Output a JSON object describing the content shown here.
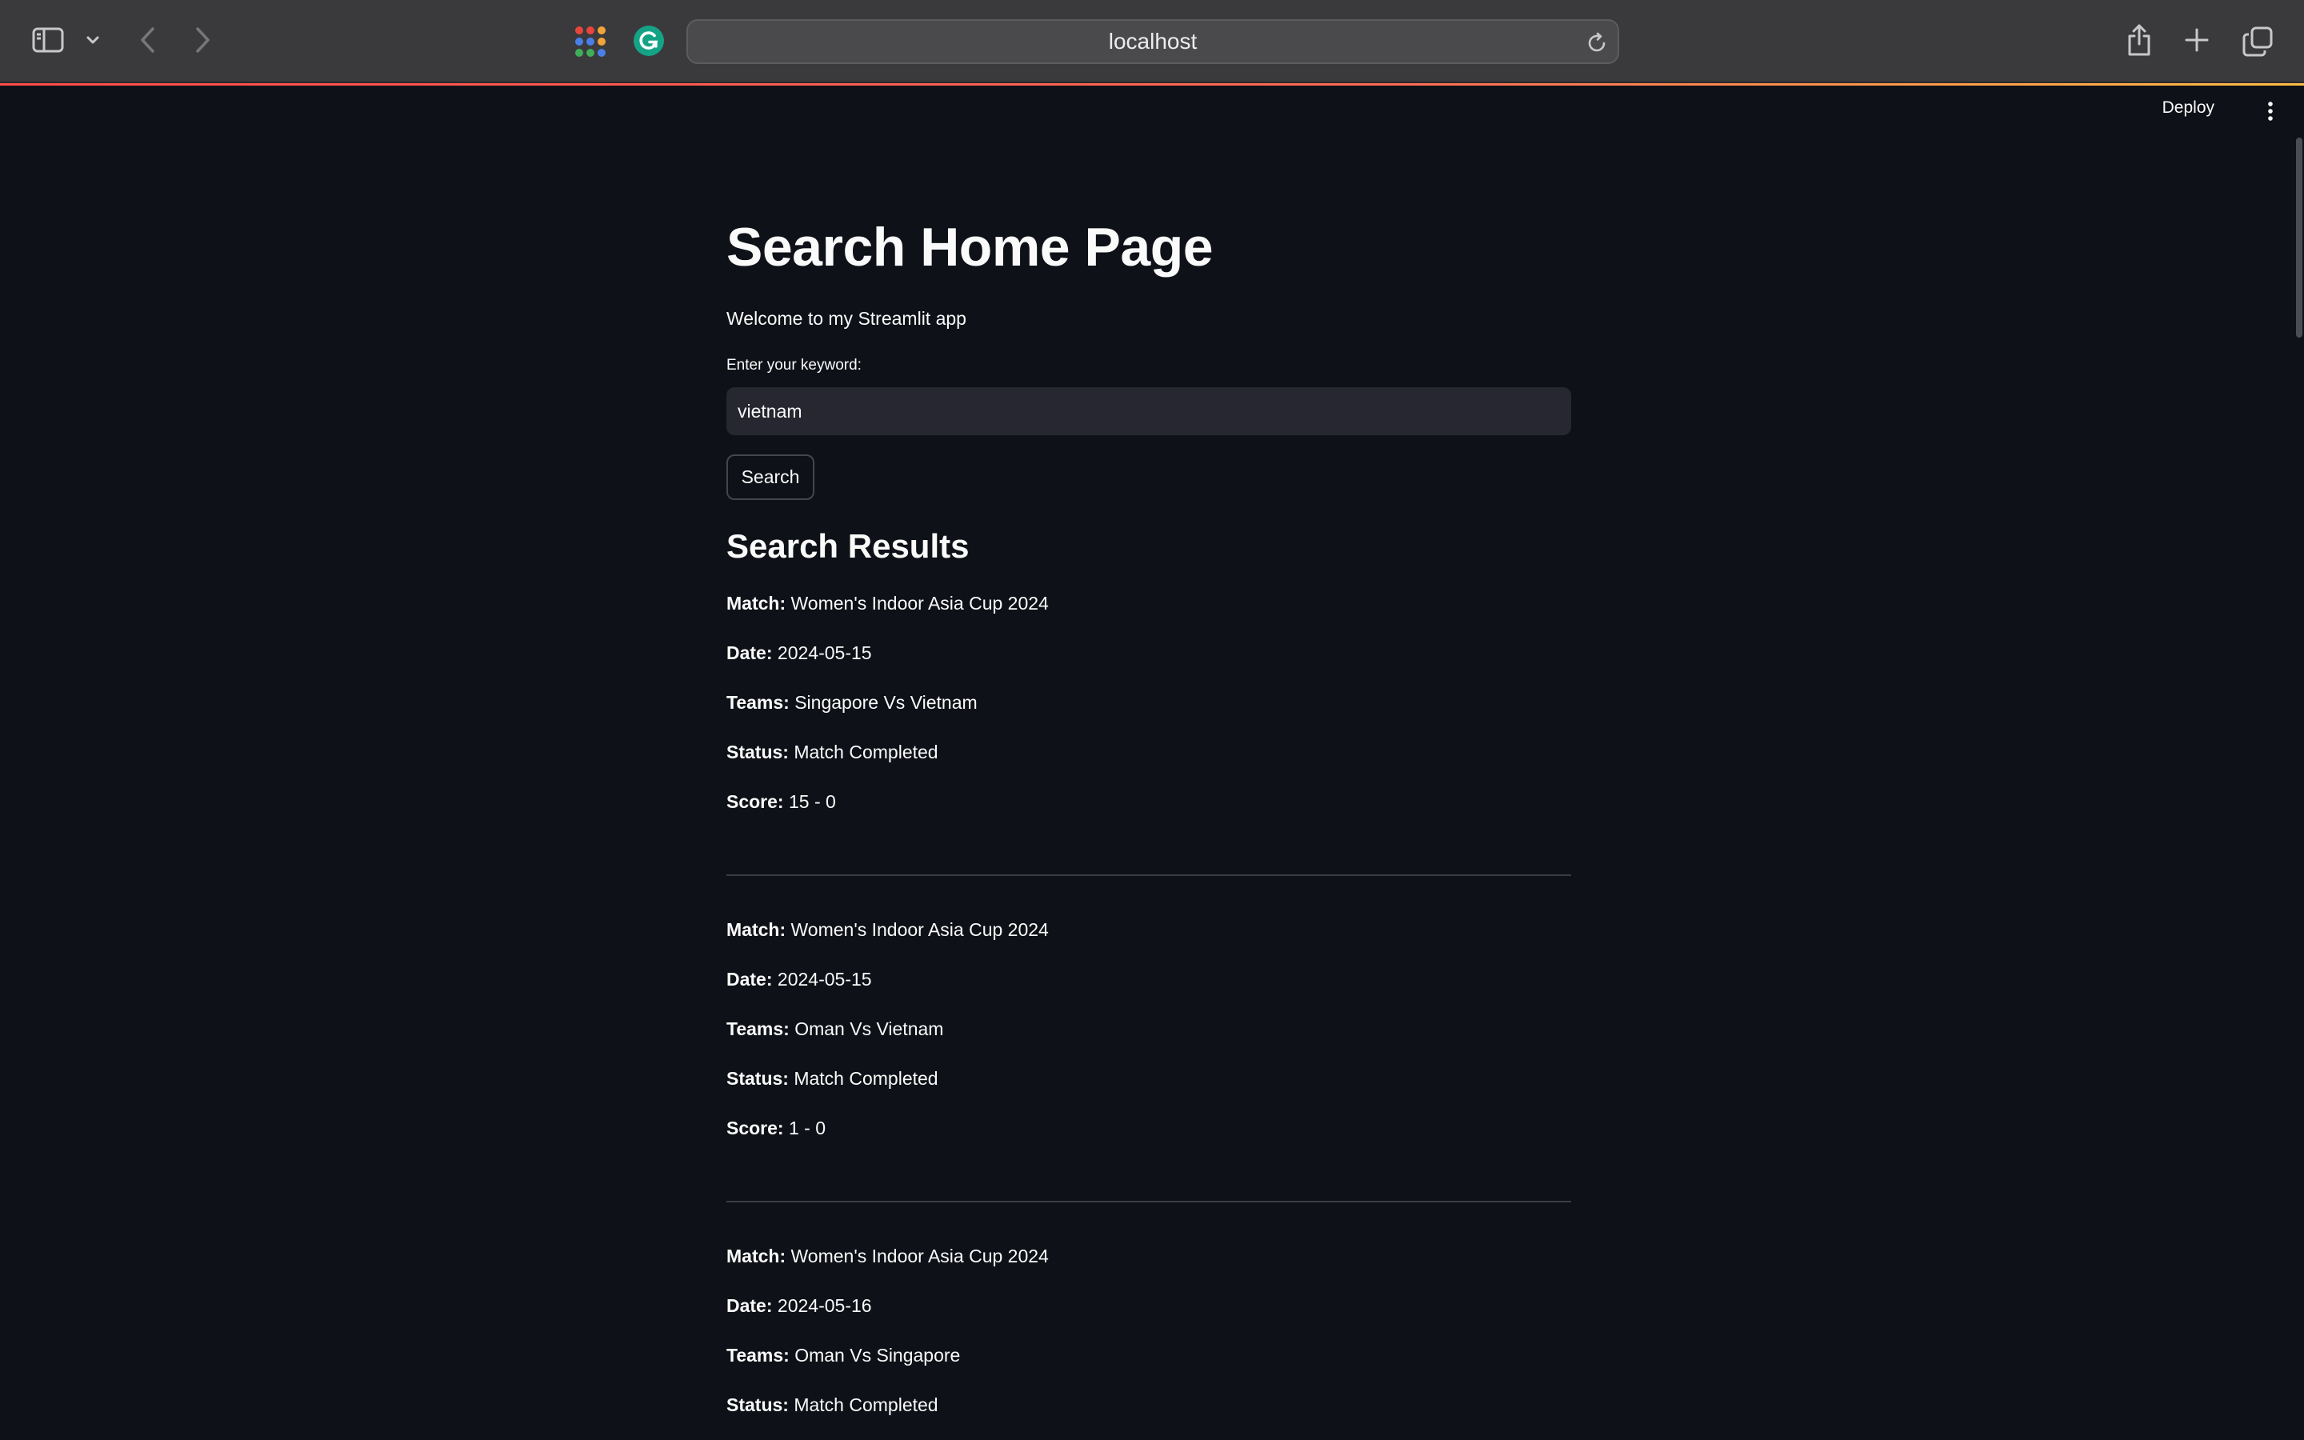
{
  "browser": {
    "address": "localhost"
  },
  "icons": {
    "sidebar": "sidebar-icon",
    "chevron": "chevron-down-icon",
    "back": "back-arrow-icon",
    "forward": "forward-arrow-icon",
    "apps": "apps-grid-icon",
    "grammarly": "grammarly-icon",
    "reload": "reload-icon",
    "share": "share-icon",
    "new_tab": "plus-icon",
    "tab_overview": "tabs-icon",
    "menu": "more-vertical-icon"
  },
  "colors": {
    "background": "#0e1117",
    "input_background": "#262730",
    "accent_red": "#ff4b4b",
    "accent_yellow": "#ffbd45"
  },
  "header": {
    "deploy_label": "Deploy"
  },
  "page": {
    "title": "Search Home Page",
    "welcome": "Welcome to my Streamlit app",
    "input_label": "Enter your keyword:",
    "input_value": "vietnam",
    "search_button": "Search",
    "results_heading": "Search Results"
  },
  "field_labels": {
    "match": "Match:",
    "date": "Date:",
    "teams": "Teams:",
    "status": "Status:",
    "score": "Score:"
  },
  "results": [
    {
      "match": "Women's Indoor Asia Cup 2024",
      "date": "2024-05-15",
      "teams": "Singapore Vs Vietnam",
      "status": "Match Completed",
      "score": "15 - 0"
    },
    {
      "match": "Women's Indoor Asia Cup 2024",
      "date": "2024-05-15",
      "teams": "Oman Vs Vietnam",
      "status": "Match Completed",
      "score": "1 - 0"
    },
    {
      "match": "Women's Indoor Asia Cup 2024",
      "date": "2024-05-16",
      "teams": "Oman Vs Singapore",
      "status": "Match Completed"
    }
  ]
}
